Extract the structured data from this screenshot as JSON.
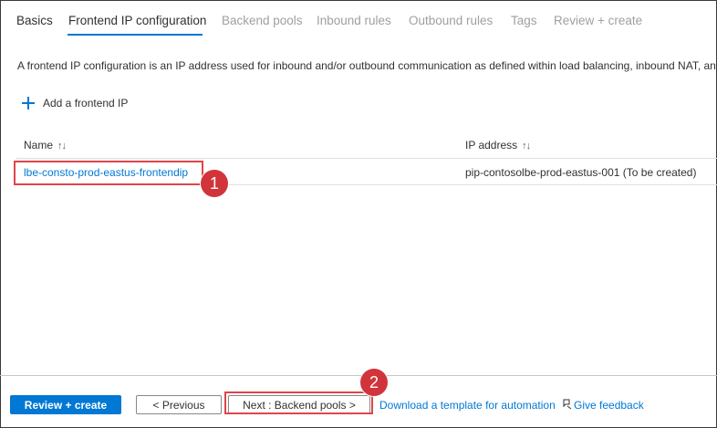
{
  "tabs": [
    {
      "label": "Basics",
      "state": "done"
    },
    {
      "label": "Frontend IP configuration",
      "state": "active"
    },
    {
      "label": "Backend pools",
      "state": "disabled"
    },
    {
      "label": "Inbound rules",
      "state": "disabled"
    },
    {
      "label": "Outbound rules",
      "state": "disabled"
    },
    {
      "label": "Tags",
      "state": "disabled"
    },
    {
      "label": "Review + create",
      "state": "disabled"
    }
  ],
  "description": "A frontend IP configuration is an IP address used for inbound and/or outbound communication as defined within load balancing, inbound NAT, and o",
  "add_button": {
    "label": "Add a frontend IP",
    "icon": "plus-icon"
  },
  "grid": {
    "columns": [
      {
        "label": "Name",
        "sort_icon": "↑↓"
      },
      {
        "label": "IP address",
        "sort_icon": "↑↓"
      }
    ],
    "rows": [
      {
        "name": "lbe-consto-prod-eastus-frontendip",
        "ip": "pip-contosolbe-prod-eastus-001 (To be created)"
      }
    ]
  },
  "callouts": {
    "one": "1",
    "two": "2"
  },
  "footer": {
    "review_create": "Review + create",
    "previous": "< Previous",
    "next": "Next : Backend pools >",
    "download_link": "Download a template for automation",
    "feedback": "Give feedback",
    "feedback_icon": "feedback-icon"
  },
  "colors": {
    "accent": "#0078d4",
    "callout": "#d1343a",
    "highlight": "#e0454b"
  }
}
